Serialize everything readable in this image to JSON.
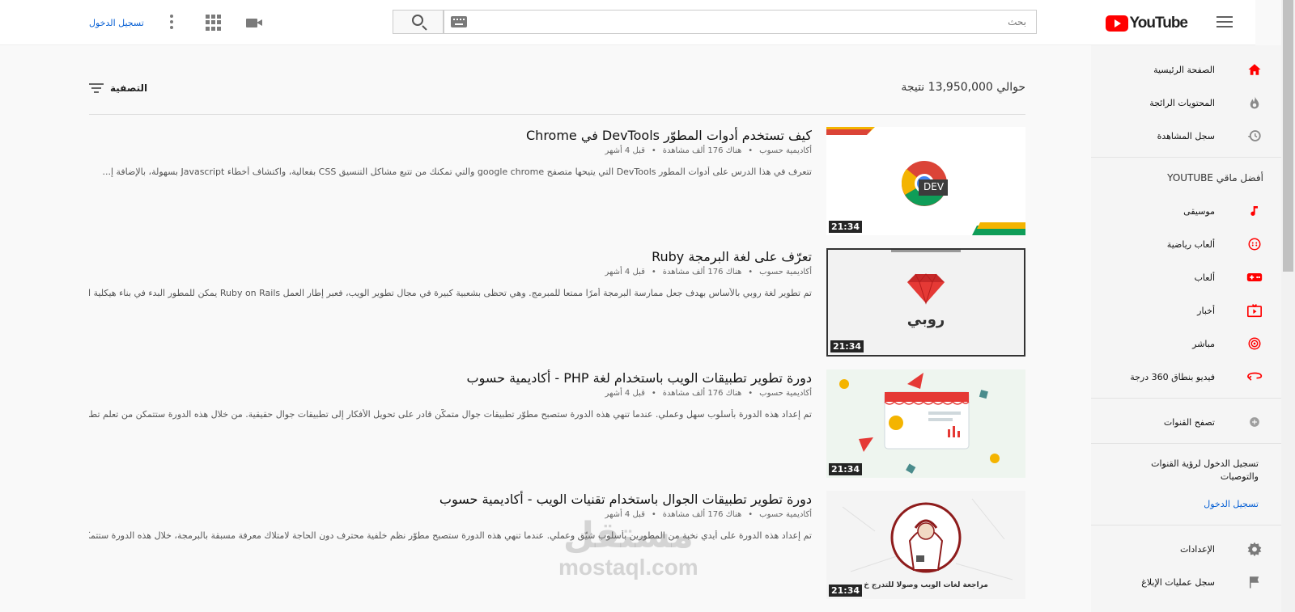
{
  "header": {
    "search_placeholder": "بحث",
    "signin": "تسجيل الدخول",
    "logo_text": "YouTube"
  },
  "sidebar": {
    "main_items": [
      {
        "label": "الصفحة الرئيسية",
        "icon": "home-icon"
      },
      {
        "label": "المحتويات الرائجة",
        "icon": "trending-icon"
      },
      {
        "label": "سجل المشاهدة",
        "icon": "history-icon"
      }
    ],
    "best_title": "أفضل ماقي YOUTUBE",
    "best_items": [
      {
        "label": "موسيقى",
        "icon": "music-icon"
      },
      {
        "label": "ألعاب رياضية",
        "icon": "sports-icon"
      },
      {
        "label": "ألعاب",
        "icon": "gaming-icon"
      },
      {
        "label": "أخبار",
        "icon": "news-icon"
      },
      {
        "label": "مباشر",
        "icon": "live-icon"
      },
      {
        "label": "فيديو بنطاق 360 درجة",
        "icon": "360-video-icon"
      }
    ],
    "browse_channels": "تصفح القنوات",
    "signin_prompt": "تسجيل الدخول لرؤية القنوات والتوصيات",
    "signin_link": "تسجيل الدخول",
    "settings": "الإعدادات",
    "report_history": "سجل عمليات الإبلاغ"
  },
  "results": {
    "count_text": "حوالي 13,950,000 نتيجة",
    "filter_label": "التصفية"
  },
  "videos": [
    {
      "title": "كيف تستخدم أدوات المطوّر DevTools في Chrome",
      "channel": "أكاديمية حسوب",
      "views": "هناك 176 ألف مشاهدة",
      "age": "قبل 4 أشهر",
      "description": "تتعرف في هذا الدرس على أدوات المطور DevTools التي يتيحها متصفح google chrome والتي تمكنك من تتبع مشاكل التنسيق CSS بفعالية، واكتشاف أخطاء Javascript بسهولة، بالإضافة إ...",
      "duration": "21:34",
      "thumb_text": "DEV"
    },
    {
      "title": "تعرّف على لغة البرمجة Ruby",
      "channel": "أكاديمية حسوب",
      "views": "هناك 176 ألف مشاهدة",
      "age": "قبل 4 أشهر",
      "description": "تم تطوير لغة روبي بالأساس بهدف جعل ممارسة البرمجة أمرًا ممتعا للمبرمج. وهي تحظى بشعبية كبيرة في مجال تطوير الويب، فعبر إطار العمل Ruby on Rails يمكن للمطور البدء في بناء هيكلية الـ ..",
      "duration": "21:34",
      "thumb_text": "روبي"
    },
    {
      "title": "دورة تطوير تطبيقات الويب باستخدام لغة PHP - أكاديمية حسوب",
      "channel": "أكاديمية حسوب",
      "views": "هناك 176 ألف مشاهدة",
      "age": "قبل 4 أشهر",
      "description": "تم إعداد هذه الدورة بأسلوب سهل وعملي. عندما تنهي هذه الدورة ستصبح مطوّر تطبيقات جوال متمكّن قادر على تحويل الأفكار إلى تطبيقات جوال حقيقية. من خلال هذه الدورة ستتمكن من تعلم تطوير تط...",
      "duration": "21:34",
      "thumb_text": ""
    },
    {
      "title": "دورة تطوير تطبيقات الجوال باستخدام تقنيات الويب - أكاديمية حسوب",
      "channel": "أكاديمية حسوب",
      "views": "هناك 176 ألف مشاهدة",
      "age": "قبل 4 أشهر",
      "description": "تم إعداد هذه الدورة على أيدي نخبة من المطورين بأسلوب شيّق وعملي. عندما تنهي هذه الدورة ستصبح مطوّر نظم خلفية محترف دون الحاجة لامتلاك معرفة مسبقة بالبرمجة، خلال هذه الدورة ستتمكن م...",
      "duration": "21:34",
      "thumb_text": "مراجعة لغات الويب وصولا للتدرج خ"
    }
  ],
  "watermark": {
    "arabic": "مستقل",
    "latin": "mostaql.com"
  },
  "colors": {
    "accent_red": "#ff0000",
    "link_blue": "#065fd4"
  }
}
